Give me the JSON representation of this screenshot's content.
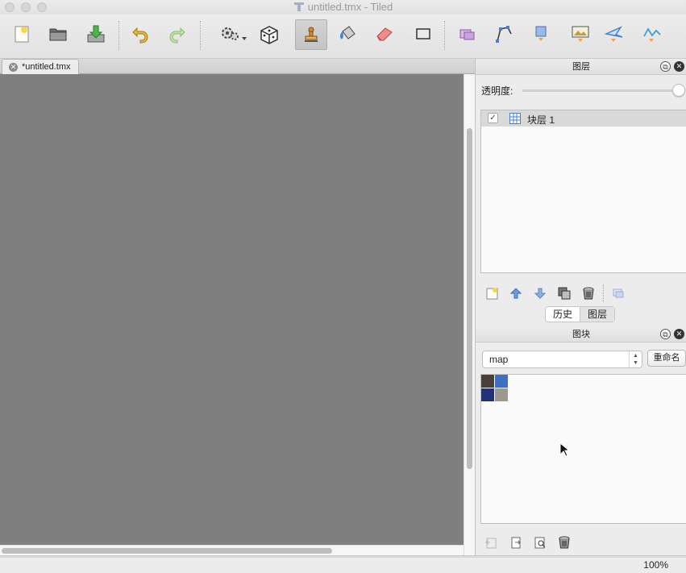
{
  "window": {
    "title": "untitled.tmx - Tiled"
  },
  "toolbar": {
    "buttons": [
      {
        "name": "new-map",
        "icon": "new-document-icon"
      },
      {
        "name": "open",
        "icon": "folder-icon"
      },
      {
        "name": "save",
        "icon": "save-download-icon"
      },
      {
        "name": "undo",
        "icon": "undo-arrow-icon"
      },
      {
        "name": "redo",
        "icon": "redo-arrow-icon"
      },
      {
        "name": "commands",
        "icon": "gears-icon"
      },
      {
        "name": "random-mode",
        "icon": "dice-icon"
      },
      {
        "name": "stamp-brush",
        "icon": "stamp-icon"
      },
      {
        "name": "bucket-fill",
        "icon": "bucket-icon"
      },
      {
        "name": "eraser",
        "icon": "eraser-icon"
      },
      {
        "name": "rectangle-select",
        "icon": "rect-select-icon"
      },
      {
        "name": "select-objects",
        "icon": "select-objects-icon"
      },
      {
        "name": "edit-polygons",
        "icon": "edit-polygon-icon"
      },
      {
        "name": "insert-rectangle",
        "icon": "insert-rect-icon"
      },
      {
        "name": "insert-image",
        "icon": "insert-image-icon"
      },
      {
        "name": "insert-polygon",
        "icon": "insert-polygon-icon"
      },
      {
        "name": "insert-polyline",
        "icon": "insert-polyline-icon"
      }
    ]
  },
  "document": {
    "tab_label": "*untitled.tmx"
  },
  "layers_panel": {
    "title": "图层",
    "opacity_label": "透明度:",
    "opacity": 1.0,
    "layers": [
      {
        "name": "块层 1",
        "visible": true,
        "selected": true
      }
    ],
    "tabs": [
      {
        "label": "历史",
        "selected": false
      },
      {
        "label": "图层",
        "selected": true
      }
    ]
  },
  "tilesets_panel": {
    "title": "图块",
    "selected_tileset": "map",
    "rename_label": "重命名",
    "tiles": [
      {
        "color": "#4a4036"
      },
      {
        "color": "#3e6fc0"
      },
      {
        "color": "#23307a"
      },
      {
        "color": "#9c9a8c"
      }
    ]
  },
  "statusbar": {
    "zoom": "100%"
  }
}
